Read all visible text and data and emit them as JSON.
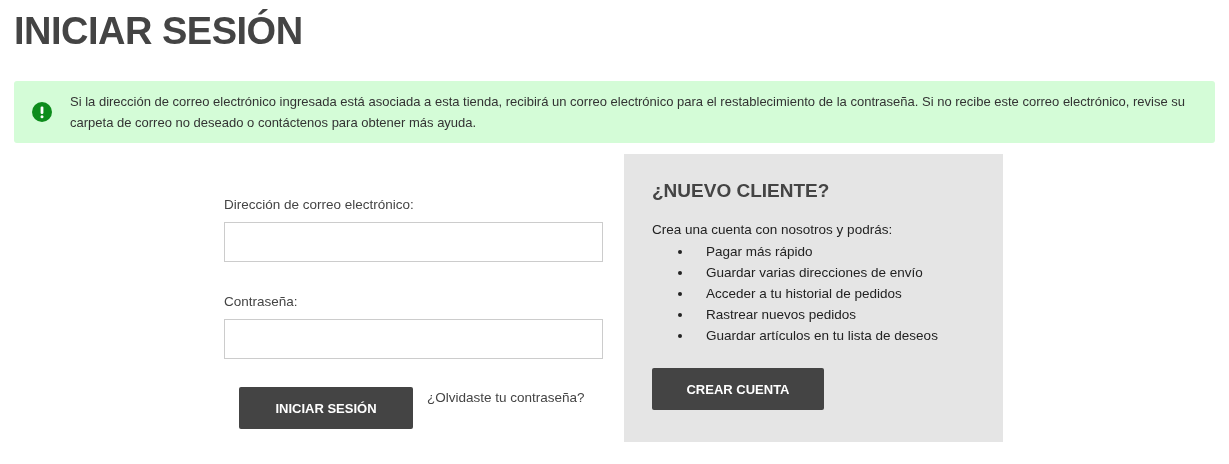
{
  "page_title": "INICIAR SESIÓN",
  "alert": {
    "kind": "success",
    "message": "Si la dirección de correo electrónico ingresada está asociada a esta tienda, recibirá un correo electrónico para el restablecimiento de la contraseña. Si no recibe este correo electrónico, revise su carpeta de correo no deseado o contáctenos para obtener más ayuda."
  },
  "login_form": {
    "fields": [
      {
        "label": "Dirección de correo electrónico:"
      },
      {
        "label": "Contraseña:"
      }
    ],
    "submit_button": "INICIAR SESIÓN",
    "forgot_link": "¿Olvidaste tu contraseña?"
  },
  "new_customer": {
    "heading": "¿NUEVO CLIENTE?",
    "intro": "Crea una cuenta con nosotros y podrás:",
    "benefits": [
      "Pagar más rápido",
      "Guardar varias direcciones de envío",
      "Acceder a tu historial de pedidos",
      "Rastrear nuevos pedidos",
      "Guardar artículos en tu lista de deseos"
    ],
    "button": "CREAR CUENTA"
  }
}
